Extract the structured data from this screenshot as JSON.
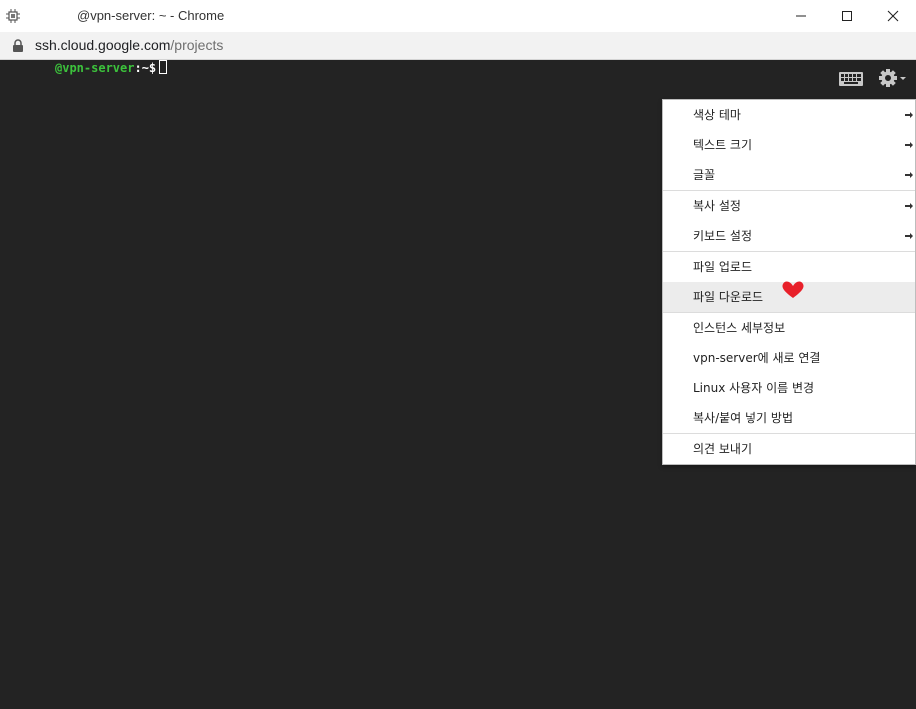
{
  "window": {
    "title": "@vpn-server: ~ - Chrome",
    "app_icon": "chip-icon",
    "controls": [
      "minimize-icon",
      "maximize-icon",
      "close-icon"
    ]
  },
  "address_bar": {
    "lock_icon": "lock-icon",
    "url_host": "ssh.cloud.google.com",
    "url_path": "/projects"
  },
  "terminal": {
    "prompt_host": "@vpn-server",
    "prompt_suffix": ":~$",
    "prompt_host_color": "#3cc23c",
    "background": "#232323"
  },
  "toolbar": {
    "keyboard_icon": "keyboard-icon",
    "settings_icon": "gear-icon"
  },
  "menu": {
    "groups": [
      {
        "items": [
          {
            "label": "색상 테마",
            "submenu": true
          },
          {
            "label": "텍스트 크기",
            "submenu": true
          },
          {
            "label": "글꼴",
            "submenu": true
          }
        ]
      },
      {
        "items": [
          {
            "label": "복사 설정",
            "submenu": true
          },
          {
            "label": "키보드 설정",
            "submenu": true
          }
        ]
      },
      {
        "items": [
          {
            "label": "파일 업로드",
            "submenu": false
          },
          {
            "label": "파일 다운로드",
            "submenu": false,
            "highlighted": true,
            "annotation": "heart-icon"
          }
        ]
      },
      {
        "items": [
          {
            "label": "인스턴스 세부정보",
            "submenu": false
          },
          {
            "label": "vpn-server에 새로 연결",
            "submenu": false
          },
          {
            "label": "Linux 사용자 이름 변경",
            "submenu": false
          },
          {
            "label": "복사/붙여 넣기 방법",
            "submenu": false
          }
        ]
      },
      {
        "items": [
          {
            "label": "의견 보내기",
            "submenu": false
          }
        ]
      }
    ]
  }
}
